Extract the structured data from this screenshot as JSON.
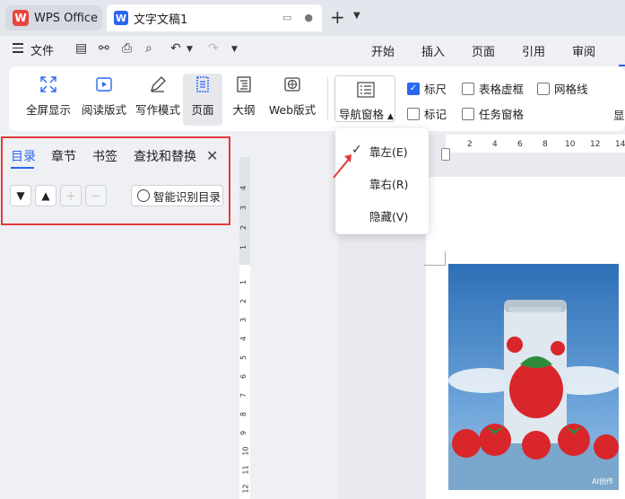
{
  "titlebar": {
    "app_name": "WPS Office",
    "doc_tab": "文字文稿1",
    "new_tab": "+",
    "new_tab_menu": "⌄"
  },
  "menubar": {
    "file": "文件",
    "tabs": [
      "开始",
      "插入",
      "页面",
      "引用",
      "审阅"
    ]
  },
  "ribbon": {
    "buttons": [
      "全屏显示",
      "阅读版式",
      "写作模式",
      "页面",
      "大纲",
      "Web版式"
    ],
    "nav_pane": "导航窗格",
    "checkboxes": [
      {
        "label": "标尺",
        "checked": true
      },
      {
        "label": "表格虚框",
        "checked": false
      },
      {
        "label": "网格线",
        "checked": false
      },
      {
        "label": "标记",
        "checked": false
      },
      {
        "label": "任务窗格",
        "checked": false
      }
    ],
    "partial": "显"
  },
  "navpanel": {
    "tabs": [
      "目录",
      "章节",
      "书签",
      "查找和替换"
    ],
    "smart_button": "智能识别目录",
    "close": "✕"
  },
  "dropdown": {
    "items": [
      "靠左(E)",
      "靠右(R)",
      "隐藏(V)"
    ],
    "checked_index": 0
  },
  "hruler": [
    "2",
    "4",
    "6",
    "8",
    "10",
    "12",
    "14"
  ],
  "vruler_top": [
    "4",
    "3",
    "2",
    "1"
  ],
  "vruler_bottom": [
    "1",
    "2",
    "3",
    "4",
    "5",
    "6",
    "7",
    "8",
    "9",
    "10",
    "11",
    "12"
  ],
  "image": {
    "watermark": "AI创作"
  },
  "colors": {
    "accent": "#2a66f0",
    "highlight": "#e23b3b"
  }
}
